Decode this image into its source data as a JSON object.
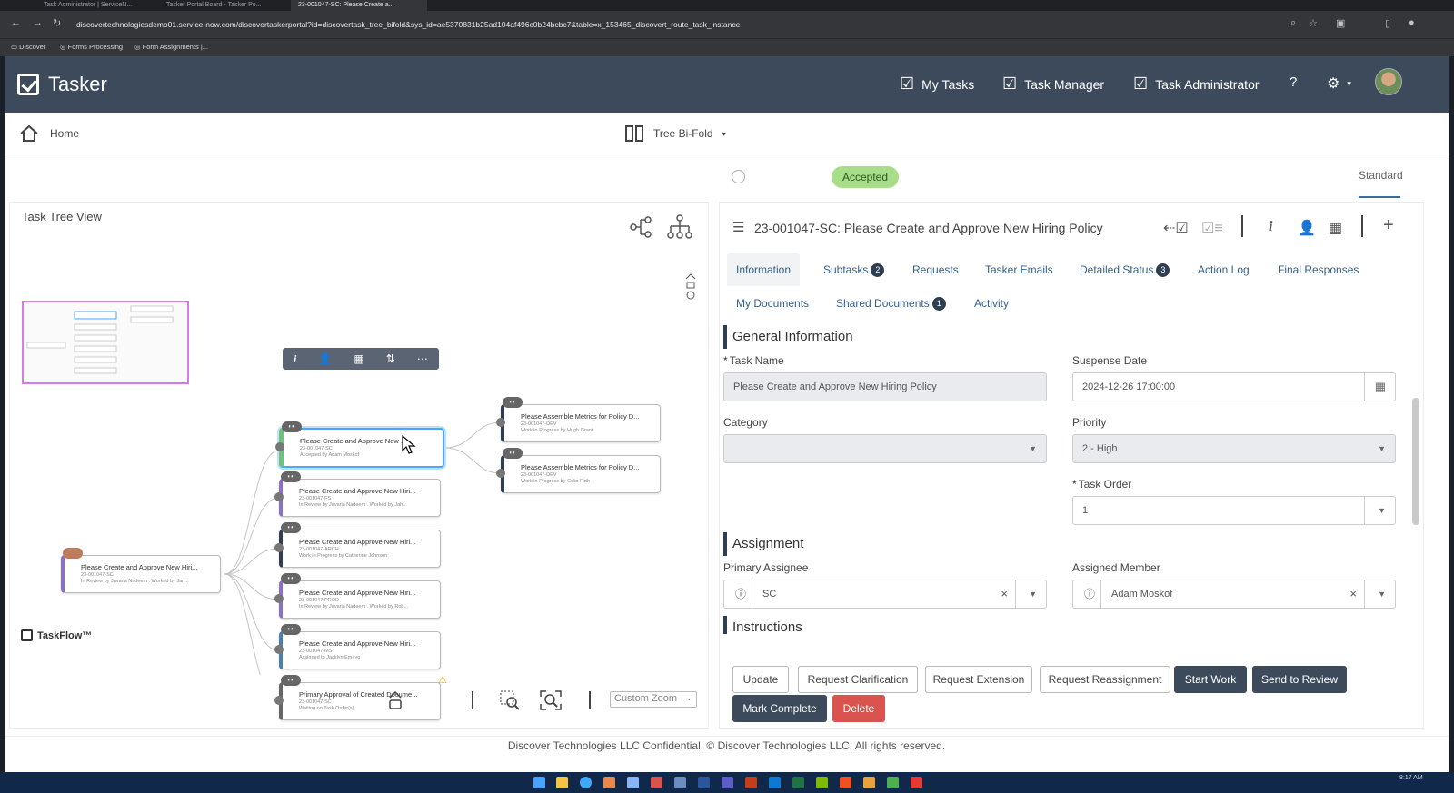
{
  "browser": {
    "tabs": [
      "Task Administrator | ServiceN...",
      "Tasker Portal Board - Tasker Po...",
      "23-001047-SC: Please Create a..."
    ],
    "url": "discovertechnologiesdemo01.service-now.com/discovertaskerportal?id=discovertask_tree_bifold&sys_id=ae5370831b25ad104af496c0b24bcbc7&table=x_153465_discovert_route_task_instance",
    "bookmarks": [
      "Discover",
      "Forms Processing",
      "Form Assignments |..."
    ]
  },
  "header": {
    "brand": "Tasker",
    "nav": [
      "My Tasks",
      "Task Manager",
      "Task Administrator"
    ],
    "help_icon": "question-circle-icon",
    "settings_icon": "gear-icon"
  },
  "subbar": {
    "home": "Home",
    "layout": "Tree Bi-Fold"
  },
  "status": {
    "dots": [
      "#ffffff",
      "#666666",
      "#f0c22e",
      "#4a7fb5",
      "#2f3e50",
      "#8a6fcf",
      "#5ec7c9"
    ],
    "current": "Accepted",
    "current_color": "#a8dd8a",
    "view_mode": "Standard"
  },
  "tree": {
    "title": "Task Tree View",
    "root": {
      "title": "Please Create and Approve New Hiri...",
      "id": "23-001047-SC",
      "meta": "In Review by Javaria Nadeem . Worked by Jan..."
    },
    "children": [
      {
        "title": "Please Create and Approve New ...",
        "id": "23-001047-SC",
        "meta": "Accepted by Adam Moskof"
      },
      {
        "title": "Please Create and Approve New Hiri...",
        "id": "23-001047-FS",
        "meta": "In Review by Javaria Nadeem . Worked by Jah..."
      },
      {
        "title": "Please Create and Approve New Hiri...",
        "id": "23-001047-ARCH",
        "meta": "Work in Progress by Catherine Johnson"
      },
      {
        "title": "Please Create and Approve New Hiri...",
        "id": "23-001047-PROD",
        "meta": "In Review by Javaria Nadeem . Worked by Rob..."
      },
      {
        "title": "Please Create and Approve New Hiri...",
        "id": "23-001047-MS",
        "meta": "Assigned to Jacklyn Emayo"
      },
      {
        "title": "Primary Approval of Created Docume...",
        "id": "23-001047-SC",
        "meta": "Waiting on Task Order(s)"
      }
    ],
    "grandchildren": [
      {
        "title": "Please Assemble Metrics for Policy D...",
        "id": "23-001047-DEV",
        "meta": "Work in Progress by Hugh Grant"
      },
      {
        "title": "Please Assemble Metrics for Policy D...",
        "id": "23-001047-DEV",
        "meta": "Work in Progress by Colin Firth"
      }
    ],
    "brand": "TaskFlow™",
    "zoom": "Custom Zoom"
  },
  "detail": {
    "title": "23-001047-SC: Please Create and Approve New Hiring Policy",
    "tabs": [
      {
        "label": "Information",
        "count": ""
      },
      {
        "label": "Subtasks",
        "count": "2"
      },
      {
        "label": "Requests",
        "count": ""
      },
      {
        "label": "Tasker Emails",
        "count": ""
      },
      {
        "label": "Detailed Status",
        "count": "3"
      },
      {
        "label": "Action Log",
        "count": ""
      },
      {
        "label": "Final Responses",
        "count": ""
      },
      {
        "label": "My Documents",
        "count": ""
      },
      {
        "label": "Shared Documents",
        "count": "1"
      },
      {
        "label": "Activity",
        "count": ""
      }
    ],
    "sections": {
      "general": "General Information",
      "assignment": "Assignment",
      "instructions": "Instructions"
    },
    "fields": {
      "task_name_label": "Task Name",
      "task_name_value": "Please Create and Approve New Hiring Policy",
      "suspense_label": "Suspense Date",
      "suspense_value": "2024-12-26 17:00:00",
      "category_label": "Category",
      "category_value": "",
      "priority_label": "Priority",
      "priority_value": "2 - High",
      "order_label": "Task Order",
      "order_value": "1",
      "primary_label": "Primary Assignee",
      "primary_value": "SC",
      "member_label": "Assigned Member",
      "member_value": "Adam Moskof"
    },
    "actions": [
      "Update",
      "Request Clarification",
      "Request Extension",
      "Request Reassignment",
      "Start Work",
      "Send to Review",
      "Mark Complete",
      "Delete"
    ]
  },
  "footer": "Discover Technologies LLC Confidential. © Discover Technologies LLC. All rights reserved.",
  "taskbar": {
    "time": "8:17 AM"
  }
}
